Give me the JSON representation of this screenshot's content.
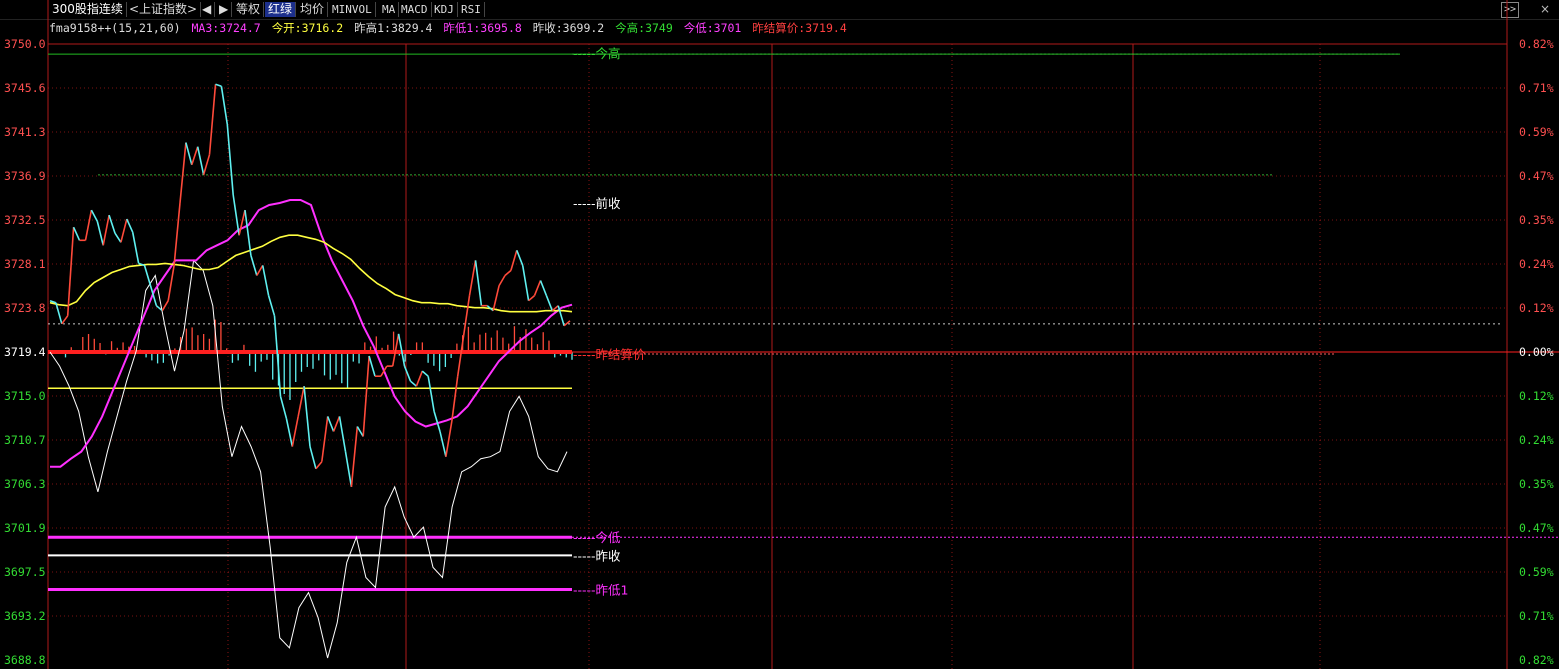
{
  "toolbar": {
    "title": "300股指连续",
    "index_button": "<上证指数>",
    "prev_arrow": "◀",
    "next_arrow": "▶",
    "items": [
      "等权",
      "红绿",
      "均价",
      "MINVOL",
      "MA",
      "MACD",
      "KDJ",
      "RSI"
    ],
    "active_item": "红绿",
    "expand_button": ">>",
    "close_button": "×"
  },
  "info": {
    "formula": "fma9158++(15,21,60)",
    "ma3": "MA3:3724.7",
    "open": "今开:3716.2",
    "prev_high": "昨高1:3829.4",
    "prev_low": "昨低1:3695.8",
    "prev_close": "昨收:3699.2",
    "today_high": "今高:3749",
    "today_low": "今低:3701",
    "prev_settle": "昨结算价:3719.4"
  },
  "colors": {
    "background": "#000000",
    "grid_red": "#b01a1a",
    "up": "#ff4a3a",
    "down": "#5ff0f0",
    "ma_yellow": "#ffff40",
    "avg_magenta": "#ff30ff",
    "white_line": "#ffffff",
    "left_axis": "#ff5050",
    "right_axis": "#ff5050",
    "green": "#33dd33"
  },
  "axis": {
    "left_ticks": [
      "3750.0",
      "3745.6",
      "3741.3",
      "3736.9",
      "3732.5",
      "3728.1",
      "3723.8",
      "3719.4",
      "3715.0",
      "3710.7",
      "3706.3",
      "3701.9",
      "3697.5",
      "3693.2",
      "3688.8"
    ],
    "right_ticks": [
      "0.82%",
      "0.71%",
      "0.59%",
      "0.47%",
      "0.35%",
      "0.24%",
      "0.12%",
      "0.00%",
      "0.12%",
      "0.24%",
      "0.35%",
      "0.47%",
      "0.59%",
      "0.71%",
      "0.82%"
    ],
    "y_max": 3750.0,
    "y_min": 3688.8
  },
  "reference_lines": {
    "today_high": {
      "label": "-----今高",
      "value": 3749.0
    },
    "prev_close_marker": {
      "label": "-----前收",
      "value": 3734.2
    },
    "prev_settle": {
      "label": "-----昨结算价",
      "value": 3719.4
    },
    "today_low": {
      "label": "-----今低",
      "value": 3701.0
    },
    "prev_close": {
      "label": "-----昨收",
      "value": 3699.2
    },
    "prev_low1": {
      "label": "-----昨低1",
      "value": 3695.8
    }
  },
  "chart_data": {
    "type": "line",
    "title": "",
    "price": [
      3724.5,
      3724.3,
      3722.2,
      3723.0,
      3731.8,
      3730.5,
      3730.5,
      3733.5,
      3732.4,
      3730.0,
      3733.0,
      3731.2,
      3730.3,
      3732.6,
      3731.3,
      3728.2,
      3728.0,
      3726.0,
      3724.0,
      3723.5,
      3724.5,
      3728.0,
      3734.2,
      3740.2,
      3738.0,
      3739.8,
      3737.0,
      3739.0,
      3746.0,
      3745.8,
      3742.0,
      3735.0,
      3731.0,
      3733.5,
      3729.0,
      3727.0,
      3728.0,
      3725.0,
      3723.0,
      3715.0,
      3712.8,
      3710.0,
      3713.0,
      3716.0,
      3710.0,
      3707.8,
      3708.5,
      3713.0,
      3711.5,
      3713.0,
      3709.5,
      3706.0,
      3712.0,
      3711.0,
      3719.0,
      3717.0,
      3717.0,
      3718.0,
      3718.0,
      3721.2,
      3718.0,
      3716.5,
      3716.0,
      3717.5,
      3717.0,
      3713.5,
      3711.5,
      3709.0,
      3712.5,
      3717.0,
      3721.0,
      3725.0,
      3728.5,
      3724.0,
      3724.0,
      3723.5,
      3726.0,
      3727.0,
      3727.5,
      3729.5,
      3728.0,
      3724.5,
      3725.0,
      3726.5,
      3725.0,
      3723.5,
      3724.0,
      3722.0,
      3722.5
    ],
    "ma_yellow": [
      3724.3,
      3724.1,
      3724.0,
      3724.4,
      3725.5,
      3726.3,
      3726.8,
      3727.3,
      3727.6,
      3727.9,
      3728.0,
      3728.1,
      3728.1,
      3728.2,
      3728.1,
      3728.0,
      3727.8,
      3727.6,
      3727.6,
      3727.8,
      3728.4,
      3729.0,
      3729.3,
      3729.6,
      3729.9,
      3730.4,
      3730.8,
      3731.0,
      3731.0,
      3730.8,
      3730.6,
      3730.3,
      3729.7,
      3729.2,
      3728.6,
      3727.7,
      3726.9,
      3726.2,
      3725.7,
      3725.1,
      3724.8,
      3724.5,
      3724.3,
      3724.3,
      3724.2,
      3724.2,
      3724.0,
      3723.9,
      3723.8,
      3723.8,
      3723.7,
      3723.5,
      3723.4,
      3723.4,
      3723.4,
      3723.4,
      3723.5,
      3723.5,
      3723.5,
      3723.4
    ],
    "ma_magenta": [
      3708.0,
      3708.0,
      3708.8,
      3709.5,
      3711.0,
      3713.0,
      3715.5,
      3718.0,
      3720.5,
      3723.0,
      3725.5,
      3727.0,
      3728.5,
      3728.5,
      3728.5,
      3729.5,
      3730.0,
      3730.5,
      3731.5,
      3732.0,
      3733.5,
      3734.0,
      3734.2,
      3734.5,
      3734.5,
      3734.0,
      3731.0,
      3728.5,
      3726.5,
      3724.5,
      3722.0,
      3720.0,
      3717.5,
      3715.0,
      3713.5,
      3712.5,
      3712.0,
      3712.3,
      3712.6,
      3713.0,
      3714.0,
      3715.5,
      3717.0,
      3718.5,
      3719.5,
      3720.5,
      3721.3,
      3722.0,
      3723.0,
      3723.8,
      3724.1
    ],
    "white_osc": [
      3719.4,
      3718.0,
      3716.0,
      3713.5,
      3709.0,
      3705.5,
      3709.5,
      3713.0,
      3716.5,
      3719.5,
      3725.5,
      3727.0,
      3722.0,
      3717.5,
      3721.5,
      3728.5,
      3727.5,
      3724.0,
      3714.0,
      3709.0,
      3712.0,
      3710.0,
      3707.5,
      3700.0,
      3691.0,
      3690.0,
      3694.0,
      3695.5,
      3693.0,
      3689.0,
      3692.5,
      3698.5,
      3701.0,
      3697.0,
      3696.0,
      3704.0,
      3706.0,
      3703.0,
      3701.0,
      3702.0,
      3698.0,
      3697.0,
      3704.0,
      3707.5,
      3708.0,
      3708.8,
      3709.0,
      3709.5,
      3713.5,
      3715.0,
      3713.0,
      3709.0,
      3707.8,
      3707.5,
      3709.5
    ],
    "volume_bars": [
      0.2,
      -0.2,
      -0.9,
      0.8,
      0.3,
      2.5,
      3.0,
      2.2,
      1.5,
      -0.4,
      1.8,
      0.7,
      1.6,
      0.9,
      1.0,
      0.4,
      -0.9,
      -1.4,
      -1.9,
      -1.8,
      -0.6,
      0.6,
      2.5,
      3.9,
      4.1,
      2.8,
      3.0,
      2.2,
      5.4,
      5.0,
      0.6,
      -1.8,
      -1.4,
      1.2,
      -2.3,
      -3.3,
      -1.6,
      -1.3,
      -4.6,
      -5.6,
      -7.0,
      -8.0,
      -5.0,
      -3.3,
      -2.5,
      -2.8,
      -1.4,
      -3.9,
      -4.6,
      -3.8,
      -5.2,
      -6.0,
      -1.6,
      -1.9,
      1.6,
      0.9,
      2.6,
      0.7,
      1.2,
      3.4,
      -0.6,
      -1.6,
      -0.5,
      1.6,
      1.6,
      -1.8,
      -2.3,
      -3.2,
      -2.5,
      -1.0,
      1.4,
      2.8,
      4.2,
      1.6,
      2.9,
      3.2,
      2.4,
      3.6,
      2.4,
      1.4,
      4.3,
      2.5,
      3.8,
      2.4,
      1.3,
      3.3,
      1.9,
      -0.9,
      -0.6,
      -0.9,
      -1.3
    ],
    "support_line": 3715.8
  }
}
